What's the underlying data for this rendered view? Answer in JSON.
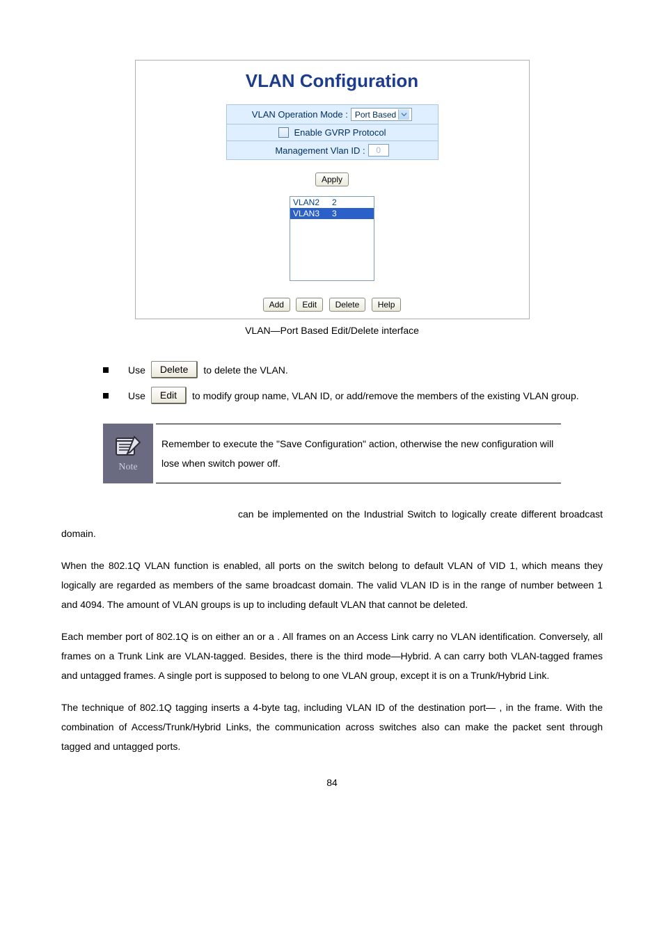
{
  "config": {
    "title": "VLAN Configuration",
    "row1_label": "VLAN Operation Mode :",
    "row1_value": "Port Based",
    "row2_label": "Enable GVRP Protocol",
    "row3_label": "Management Vlan ID :",
    "row3_value": "0",
    "apply": "Apply",
    "list0_name": "VLAN2",
    "list0_id": "2",
    "list1_name": "VLAN3",
    "list1_id": "3",
    "btn_add": "Add",
    "btn_edit": "Edit",
    "btn_delete": "Delete",
    "btn_help": "Help"
  },
  "caption": "VLAN—Port Based Edit/Delete interface",
  "b1_pre": "Use",
  "b1_btn": "Delete",
  "b1_post": " to delete the VLAN.",
  "b2_pre": "Use",
  "b2_btn": "Edit",
  "b2_post": " to modify group name, VLAN ID, or add/remove the members of the existing VLAN group.",
  "note_label": "Note",
  "note_text": "Remember to execute the \"Save Configuration\" action, otherwise the new configuration will lose when switch power off.",
  "para1": " can be implemented on the Industrial Switch to logically create different broadcast domain.",
  "para2": "When the 802.1Q VLAN function is enabled, all ports on the switch belong to default VLAN of VID 1, which means they logically are regarded as members of the same broadcast domain. The valid VLAN ID is in the range of number between 1 and 4094. The amount of VLAN groups is up to      including default VLAN that cannot be deleted.",
  "para3": "Each member port of 802.1Q is on either an                                                              or a                                            . All frames on an Access Link carry no VLAN identification. Conversely, all frames on a Trunk Link are VLAN-tagged. Besides, there is the third mode—Hybrid. A                    can carry both VLAN-tagged frames and untagged frames. A single port is supposed to belong to one VLAN group, except it is on a Trunk/Hybrid Link.",
  "para4": "The technique of 802.1Q tagging inserts a 4-byte tag, including VLAN ID of the destination port—       , in the frame. With the combination of Access/Trunk/Hybrid Links, the communication across switches also can make the packet sent through tagged and untagged ports.",
  "page_num": "84"
}
